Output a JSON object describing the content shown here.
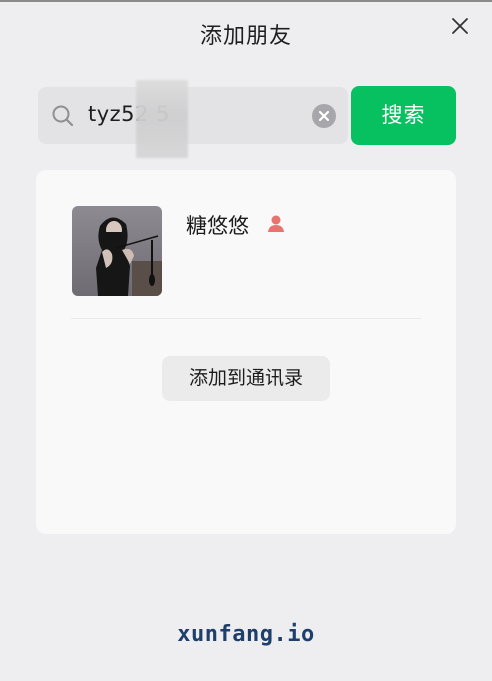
{
  "dialog": {
    "title": "添加朋友",
    "close_icon": "close-icon"
  },
  "search": {
    "value": "tyz52    5",
    "icon": "search-icon",
    "clear_icon": "clear-icon",
    "button_label": "搜索",
    "button_color": "#07c160"
  },
  "result": {
    "name": "糖悠悠",
    "gender_icon": "female-icon",
    "gender_color": "#e8736f",
    "add_button_label": "添加到通讯录"
  },
  "watermark": {
    "text": "xunfang.io"
  }
}
